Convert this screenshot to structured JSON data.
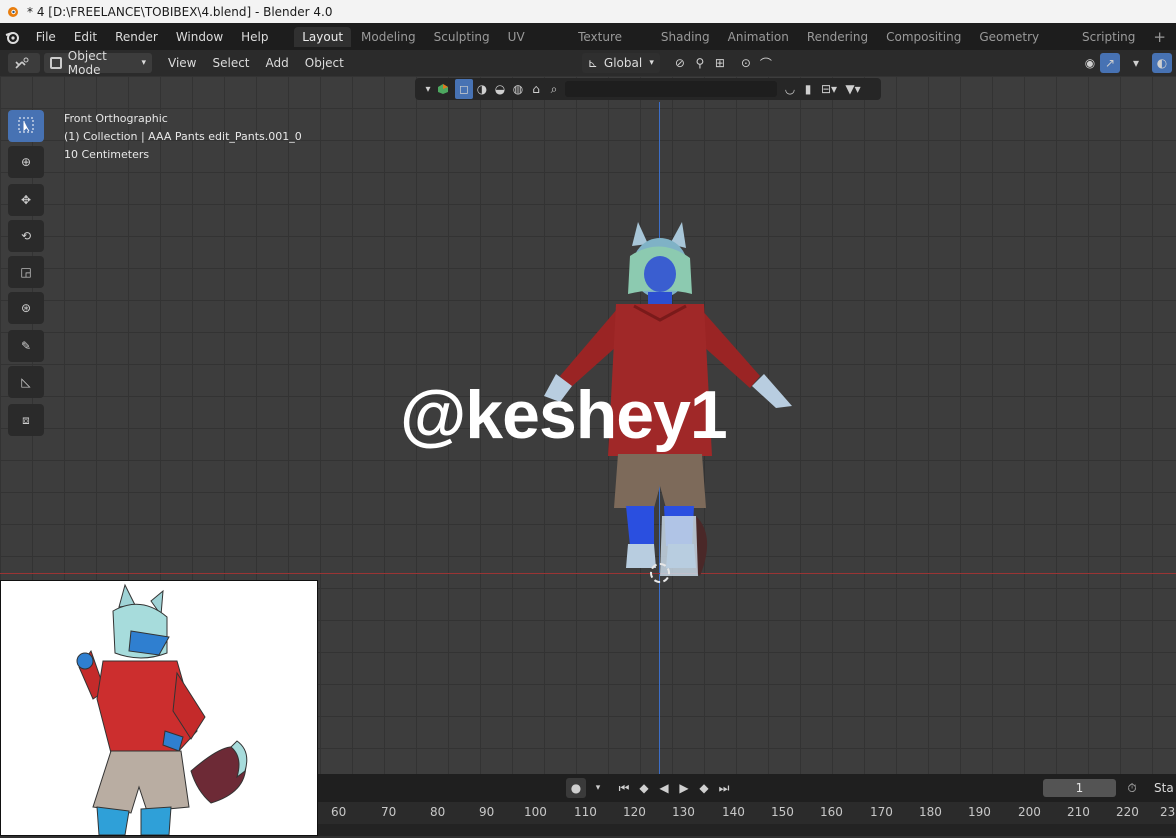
{
  "window": {
    "title": "* 4 [D:\\FREELANCE\\TOBIBEX\\4.blend] - Blender 4.0"
  },
  "menubar": {
    "items": [
      "File",
      "Edit",
      "Render",
      "Window",
      "Help"
    ],
    "workspaces": [
      "Layout",
      "Modeling",
      "Sculpting",
      "UV Editing",
      "Texture Paint",
      "Shading",
      "Animation",
      "Rendering",
      "Compositing",
      "Geometry Nodes",
      "Scripting"
    ],
    "active_workspace": "Layout",
    "add_tab_glyph": "+"
  },
  "header": {
    "mode": "Object Mode",
    "menus": [
      "View",
      "Select",
      "Add",
      "Object"
    ],
    "orientation": "Global"
  },
  "viewport": {
    "view_name": "Front Orthographic",
    "collection": "(1) Collection | AAA Pants edit_Pants.001_0",
    "scale": "10 Centimeters",
    "watermark": "@keshey1",
    "colors": {
      "x_axis": "#9a3434",
      "z_axis": "#3c6ec7",
      "active_tool": "#4772b3"
    }
  },
  "toolshelf": {
    "tools": [
      "select-box-icon",
      "cursor-icon",
      "move-icon",
      "rotate-icon",
      "scale-icon",
      "transform-icon",
      "annotate-icon",
      "measure-icon",
      "add-cube-icon"
    ]
  },
  "timeline": {
    "current_frame": "1",
    "start_label": "Sta",
    "ticks": [
      "60",
      "70",
      "80",
      "90",
      "100",
      "110",
      "120",
      "130",
      "140",
      "150",
      "160",
      "170",
      "180",
      "190",
      "200",
      "210",
      "220",
      "23"
    ]
  }
}
